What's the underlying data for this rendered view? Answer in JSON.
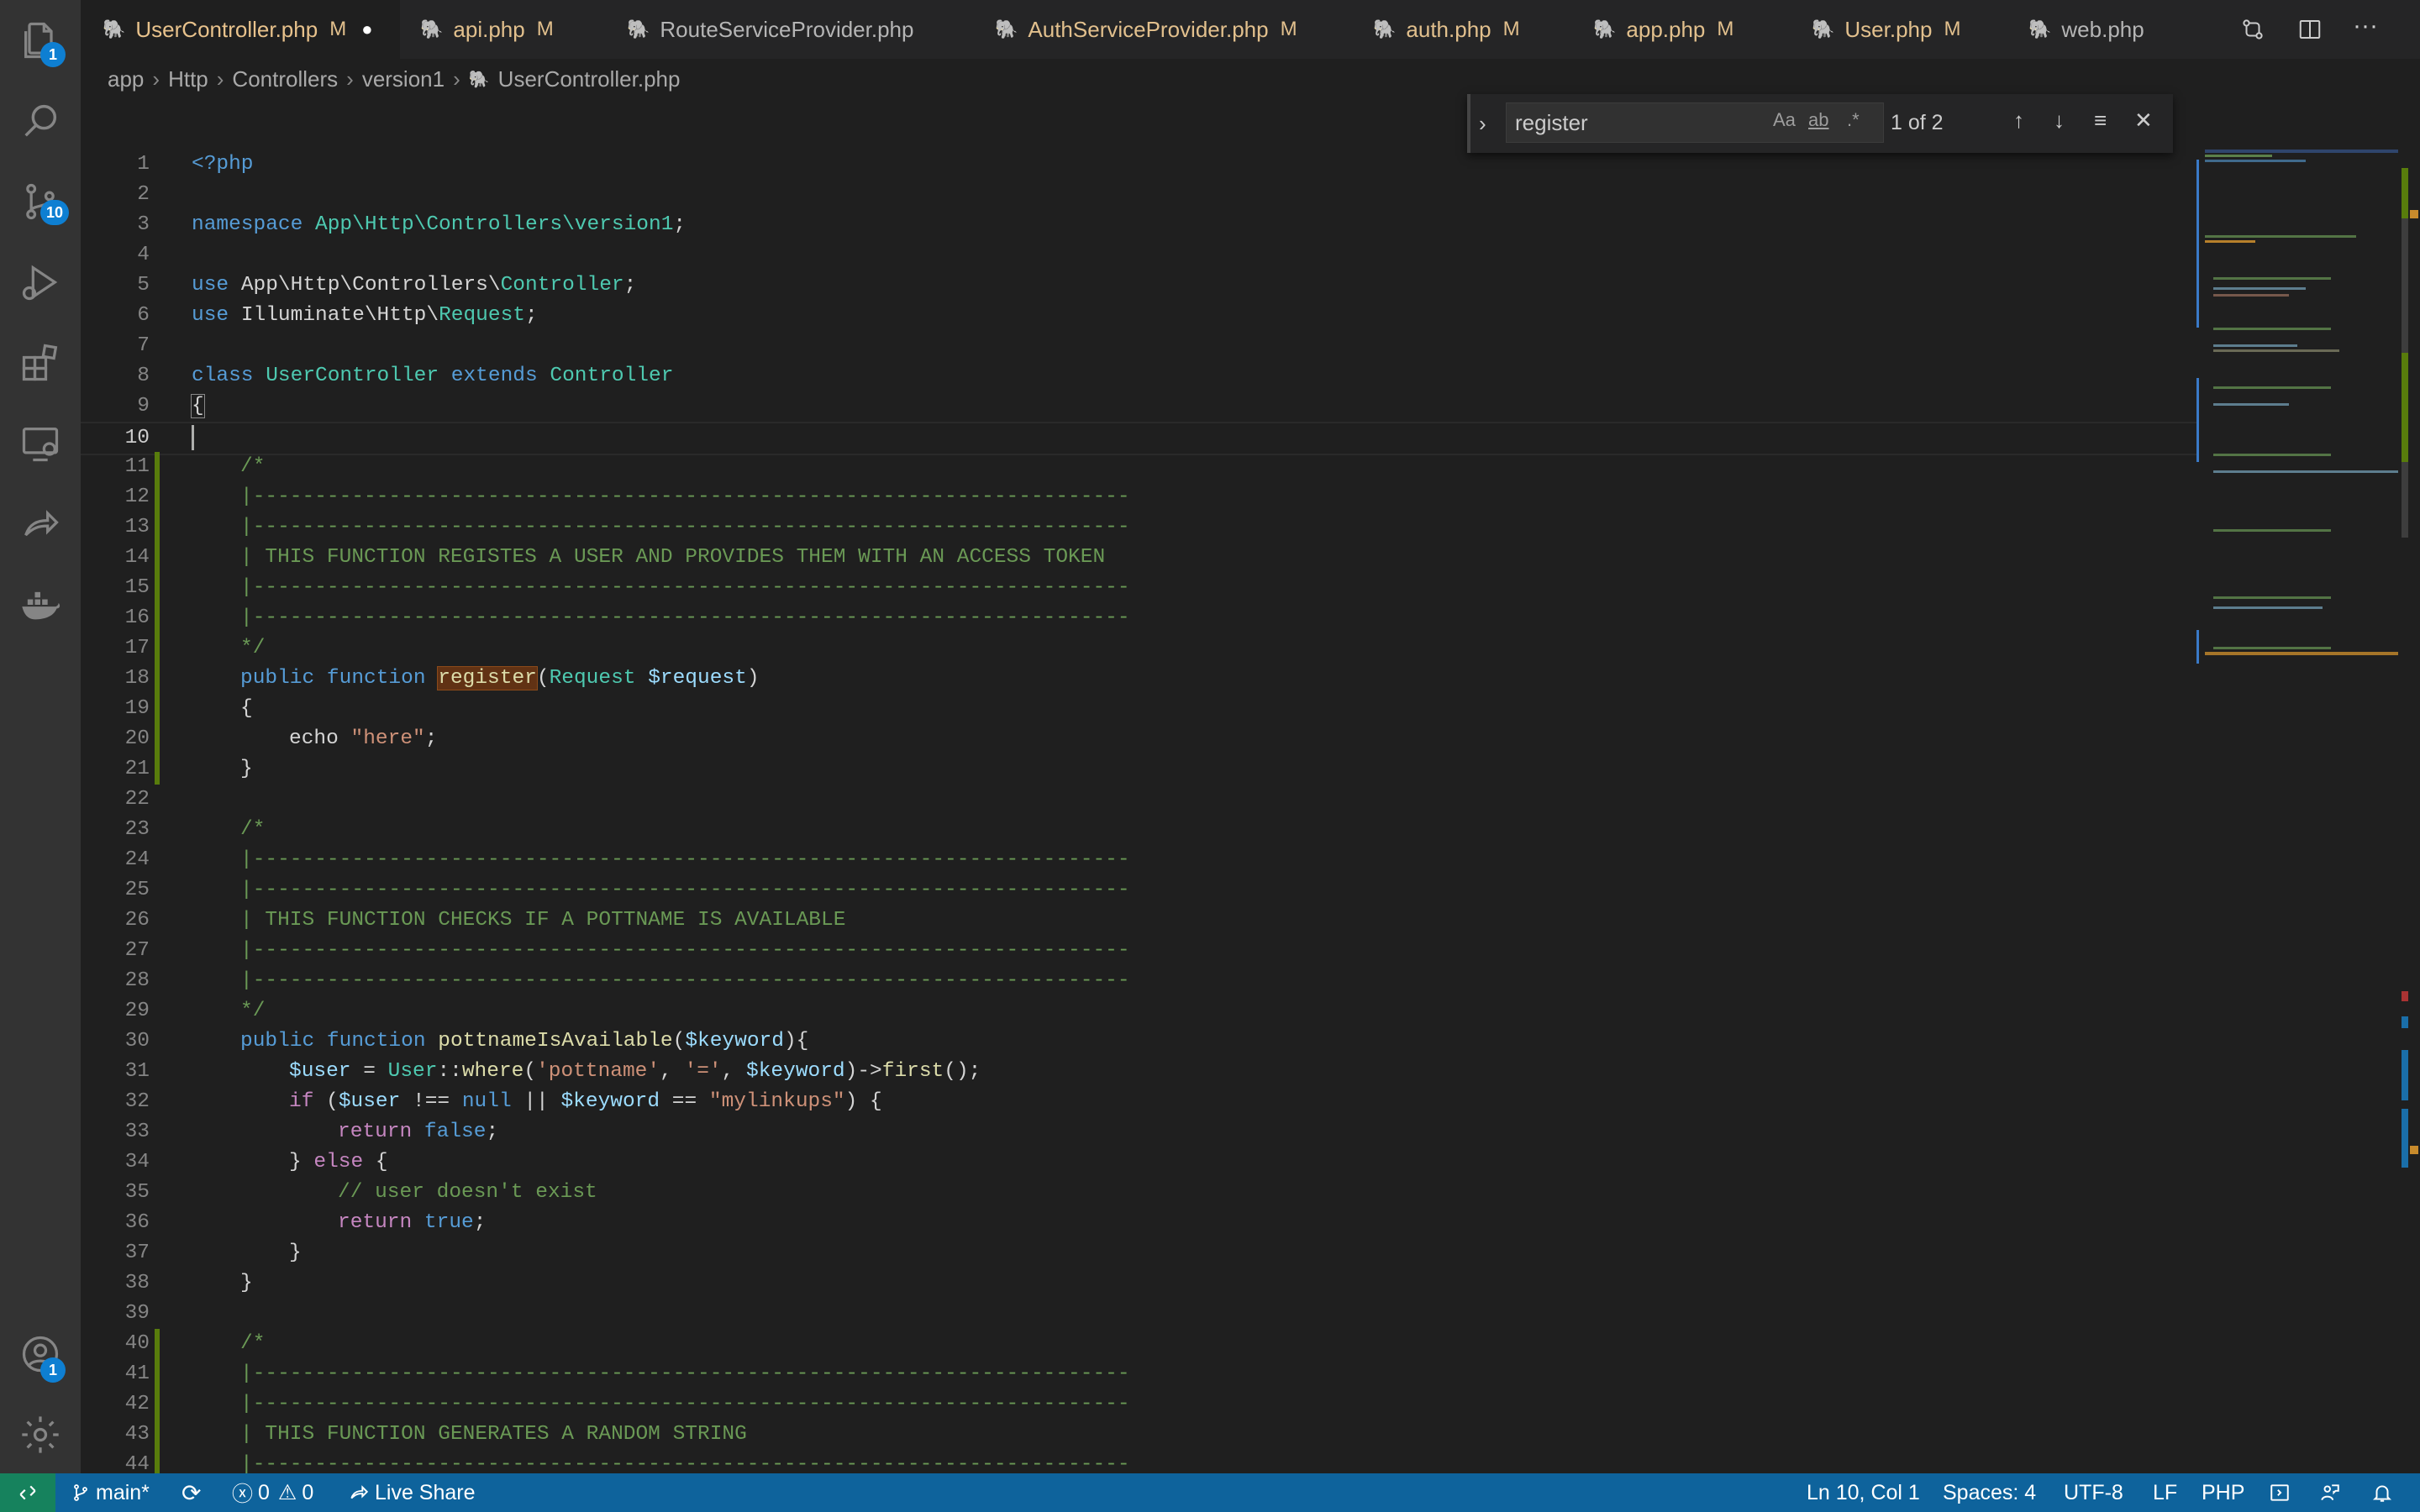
{
  "activity_bar": {
    "explorer_badge": "1",
    "source_control_badge": "10",
    "accounts_badge": "1"
  },
  "tabs": [
    {
      "label": "UserController.php",
      "status": "M",
      "dirty": "●"
    },
    {
      "label": "api.php",
      "status": "M"
    },
    {
      "label": "RouteServiceProvider.php",
      "status": ""
    },
    {
      "label": "AuthServiceProvider.php",
      "status": "M"
    },
    {
      "label": "auth.php",
      "status": "M"
    },
    {
      "label": "app.php",
      "status": "M"
    },
    {
      "label": "User.php",
      "status": "M"
    },
    {
      "label": "web.php",
      "status": ""
    }
  ],
  "breadcrumb": [
    "app",
    "Http",
    "Controllers",
    "version1",
    "UserController.php"
  ],
  "find": {
    "query": "register",
    "match_case": "Aa",
    "whole_word": "ab",
    "regex": ".*",
    "count": "1 of 2"
  },
  "editor": {
    "current_line": 10,
    "line_numbers": [
      "1",
      "2",
      "3",
      "4",
      "5",
      "6",
      "7",
      "8",
      "9",
      "10",
      "11",
      "12",
      "13",
      "14",
      "15",
      "16",
      "17",
      "18",
      "19",
      "20",
      "21",
      "22",
      "23",
      "24",
      "25",
      "26",
      "27",
      "28",
      "29",
      "30",
      "31",
      "32",
      "33",
      "34",
      "35",
      "36",
      "37",
      "38",
      "39",
      "40",
      "41",
      "42",
      "43",
      "44"
    ],
    "code": {
      "l1": "<?php",
      "l3_kw": "namespace",
      "l3_ns": "App\\Http\\Controllers\\version1",
      "l3_end": ";",
      "l5_kw": "use",
      "l5_path": "App\\Http\\Controllers\\",
      "l5_cls": "Controller",
      "l5_end": ";",
      "l6_kw": "use",
      "l6_path": "Illuminate\\Http\\",
      "l6_cls": "Request",
      "l6_end": ";",
      "l8_kw": "class",
      "l8_name": "UserController",
      "l8_ext": "extends",
      "l8_parent": "Controller",
      "l9": "{",
      "l11": "/*",
      "dashes": "|-----------------------------------------------------------------------",
      "l14": "| THIS FUNCTION REGISTES A USER AND PROVIDES THEM WITH AN ACCESS TOKEN",
      "l17": "*/",
      "l18_pub": "public",
      "l18_fn": "function",
      "l18_name": "register",
      "l18_open": "(",
      "l18_type": "Request",
      "l18_var": "$request",
      "l18_close": ")",
      "l19": "{",
      "l20_echo": "echo",
      "l20_str": "\"here\"",
      "l20_end": ";",
      "l21": "}",
      "l23": "/*",
      "l26": "| THIS FUNCTION CHECKS IF A POTTNAME IS AVAILABLE",
      "l29": "*/",
      "l30_pub": "public",
      "l30_fn": "function",
      "l30_name": "pottnameIsAvailable",
      "l30_open": "(",
      "l30_var": "$keyword",
      "l30_close": "){",
      "l31_var": "$user",
      "l31_eq": " = ",
      "l31_cls": "User",
      "l31_sep": "::",
      "l31_where": "where",
      "l31_p1": "(",
      "l31_s1": "'pottname'",
      "l31_c1": ", ",
      "l31_s2": "'='",
      "l31_c2": ", ",
      "l31_v2": "$keyword",
      "l31_p2": ")->",
      "l31_first": "first",
      "l31_end": "();",
      "l32_if": "if",
      "l32_a": " (",
      "l32_v1": "$user",
      "l32_b": " !== ",
      "l32_null": "null",
      "l32_c": " || ",
      "l32_v2": "$keyword",
      "l32_d": " == ",
      "l32_s": "\"mylinkups\"",
      "l32_e": ") {",
      "l33_ret": "return",
      "l33_val": "false",
      "l33_end": ";",
      "l34_a": "} ",
      "l34_else": "else",
      "l34_b": " {",
      "l35": "// user doesn't exist",
      "l36_ret": "return",
      "l36_val": "true",
      "l36_end": ";",
      "l37": "}",
      "l38": "}",
      "l40": "/*",
      "l43": "| THIS FUNCTION GENERATES A RANDOM STRING"
    }
  },
  "status_bar": {
    "branch": "main*",
    "errors": "0",
    "warnings": "0",
    "live_share": "Live Share",
    "position": "Ln 10, Col 1",
    "spaces": "Spaces: 4",
    "encoding": "UTF-8",
    "eol": "LF",
    "language": "PHP"
  }
}
